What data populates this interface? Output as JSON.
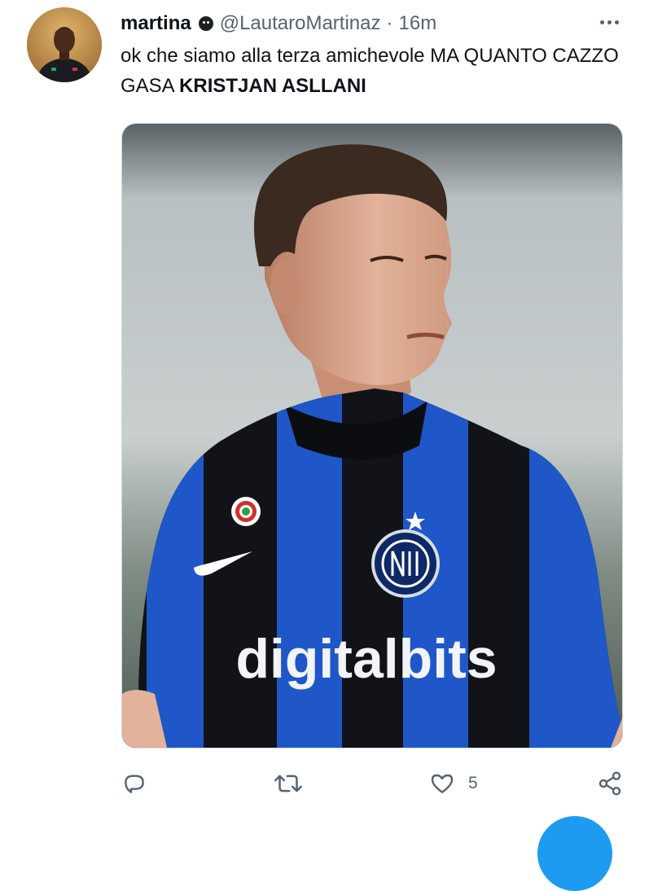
{
  "tweet": {
    "display_name": "martina",
    "handle": "@LautaroMartinaz",
    "separator": "·",
    "time": "16m",
    "text_normal": "ok che siamo alla terza amichevole MA QUANTO CAZZO GASA",
    "text_bold": "KRISTJAN ASLLANI",
    "avatar_icon": "avatar-photo",
    "name_emoji_icon": "dark-face-emoji-icon",
    "more_icon": "more-dots-icon"
  },
  "media": {
    "sponsor_text": "digitalbits",
    "image_alt": "football player in blue and black striped kit",
    "jersey_colors": {
      "blue": "#1f57c8",
      "black": "#111318"
    }
  },
  "actions": {
    "reply_icon": "reply-icon",
    "retweet_icon": "retweet-icon",
    "like_icon": "heart-icon",
    "like_count": "5",
    "share_icon": "share-icon"
  },
  "accent": "#1d9bf0"
}
